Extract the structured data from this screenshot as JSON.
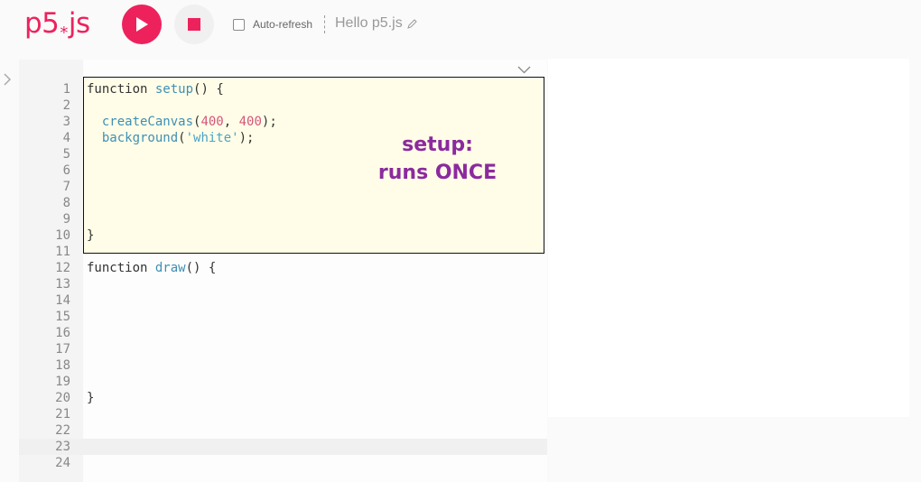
{
  "header": {
    "logo_left": "p5",
    "logo_star": "*",
    "logo_right": "js",
    "autorefresh_label": "Auto-refresh",
    "sketch_name": "Hello p5.js"
  },
  "editor": {
    "lines": [
      {
        "n": "1"
      },
      {
        "n": "2"
      },
      {
        "n": "3"
      },
      {
        "n": "4"
      },
      {
        "n": "5"
      },
      {
        "n": "6"
      },
      {
        "n": "7"
      },
      {
        "n": "8"
      },
      {
        "n": "9"
      },
      {
        "n": "10"
      },
      {
        "n": "11"
      },
      {
        "n": "12"
      },
      {
        "n": "13"
      },
      {
        "n": "14"
      },
      {
        "n": "15"
      },
      {
        "n": "16"
      },
      {
        "n": "17"
      },
      {
        "n": "18"
      },
      {
        "n": "19"
      },
      {
        "n": "20"
      },
      {
        "n": "21"
      },
      {
        "n": "22"
      },
      {
        "n": "23"
      },
      {
        "n": "24"
      }
    ],
    "code": {
      "l1_kw": "function",
      "l1_name": "setup",
      "l1_rest": "() {",
      "l3_fn": "createCanvas",
      "l3_open": "(",
      "l3_a": "400",
      "l3_sep": ", ",
      "l3_b": "400",
      "l3_close": ");",
      "l4_fn": "background",
      "l4_open": "(",
      "l4_str": "'white'",
      "l4_close": ");",
      "l10": "}",
      "l12_kw": "function",
      "l12_name": "draw",
      "l12_rest": "() {",
      "l20": "}"
    },
    "active_line": 23
  },
  "annotation": {
    "line1": "setup:",
    "line2": "runs ONCE"
  },
  "colors": {
    "accent": "#ed225d",
    "annotation": "#8b2a9e",
    "highlight_bg": "#fffde7"
  }
}
